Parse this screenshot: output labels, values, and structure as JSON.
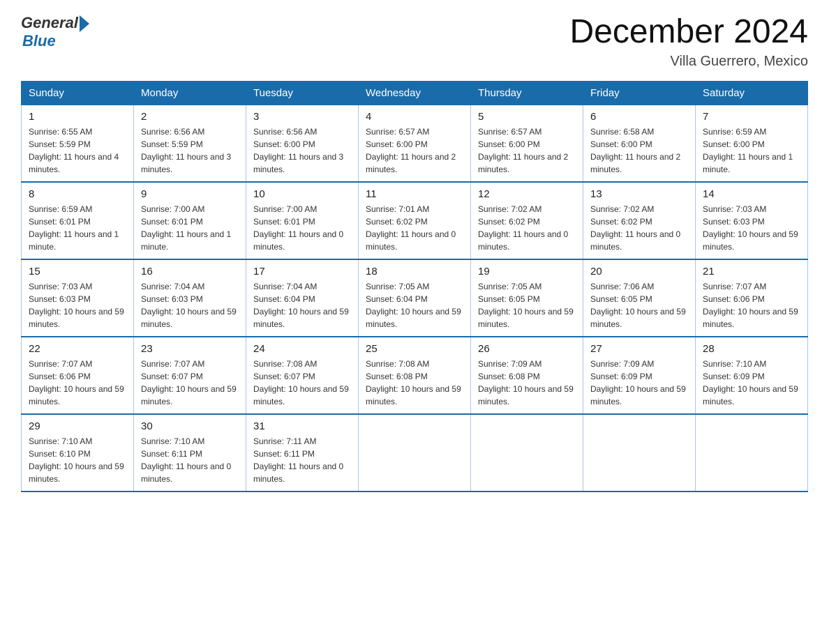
{
  "header": {
    "logo_general": "General",
    "logo_blue": "Blue",
    "month_title": "December 2024",
    "location": "Villa Guerrero, Mexico"
  },
  "weekdays": [
    "Sunday",
    "Monday",
    "Tuesday",
    "Wednesday",
    "Thursday",
    "Friday",
    "Saturday"
  ],
  "weeks": [
    [
      {
        "day": "1",
        "sunrise": "6:55 AM",
        "sunset": "5:59 PM",
        "daylight": "11 hours and 4 minutes."
      },
      {
        "day": "2",
        "sunrise": "6:56 AM",
        "sunset": "5:59 PM",
        "daylight": "11 hours and 3 minutes."
      },
      {
        "day": "3",
        "sunrise": "6:56 AM",
        "sunset": "6:00 PM",
        "daylight": "11 hours and 3 minutes."
      },
      {
        "day": "4",
        "sunrise": "6:57 AM",
        "sunset": "6:00 PM",
        "daylight": "11 hours and 2 minutes."
      },
      {
        "day": "5",
        "sunrise": "6:57 AM",
        "sunset": "6:00 PM",
        "daylight": "11 hours and 2 minutes."
      },
      {
        "day": "6",
        "sunrise": "6:58 AM",
        "sunset": "6:00 PM",
        "daylight": "11 hours and 2 minutes."
      },
      {
        "day": "7",
        "sunrise": "6:59 AM",
        "sunset": "6:00 PM",
        "daylight": "11 hours and 1 minute."
      }
    ],
    [
      {
        "day": "8",
        "sunrise": "6:59 AM",
        "sunset": "6:01 PM",
        "daylight": "11 hours and 1 minute."
      },
      {
        "day": "9",
        "sunrise": "7:00 AM",
        "sunset": "6:01 PM",
        "daylight": "11 hours and 1 minute."
      },
      {
        "day": "10",
        "sunrise": "7:00 AM",
        "sunset": "6:01 PM",
        "daylight": "11 hours and 0 minutes."
      },
      {
        "day": "11",
        "sunrise": "7:01 AM",
        "sunset": "6:02 PM",
        "daylight": "11 hours and 0 minutes."
      },
      {
        "day": "12",
        "sunrise": "7:02 AM",
        "sunset": "6:02 PM",
        "daylight": "11 hours and 0 minutes."
      },
      {
        "day": "13",
        "sunrise": "7:02 AM",
        "sunset": "6:02 PM",
        "daylight": "11 hours and 0 minutes."
      },
      {
        "day": "14",
        "sunrise": "7:03 AM",
        "sunset": "6:03 PM",
        "daylight": "10 hours and 59 minutes."
      }
    ],
    [
      {
        "day": "15",
        "sunrise": "7:03 AM",
        "sunset": "6:03 PM",
        "daylight": "10 hours and 59 minutes."
      },
      {
        "day": "16",
        "sunrise": "7:04 AM",
        "sunset": "6:03 PM",
        "daylight": "10 hours and 59 minutes."
      },
      {
        "day": "17",
        "sunrise": "7:04 AM",
        "sunset": "6:04 PM",
        "daylight": "10 hours and 59 minutes."
      },
      {
        "day": "18",
        "sunrise": "7:05 AM",
        "sunset": "6:04 PM",
        "daylight": "10 hours and 59 minutes."
      },
      {
        "day": "19",
        "sunrise": "7:05 AM",
        "sunset": "6:05 PM",
        "daylight": "10 hours and 59 minutes."
      },
      {
        "day": "20",
        "sunrise": "7:06 AM",
        "sunset": "6:05 PM",
        "daylight": "10 hours and 59 minutes."
      },
      {
        "day": "21",
        "sunrise": "7:07 AM",
        "sunset": "6:06 PM",
        "daylight": "10 hours and 59 minutes."
      }
    ],
    [
      {
        "day": "22",
        "sunrise": "7:07 AM",
        "sunset": "6:06 PM",
        "daylight": "10 hours and 59 minutes."
      },
      {
        "day": "23",
        "sunrise": "7:07 AM",
        "sunset": "6:07 PM",
        "daylight": "10 hours and 59 minutes."
      },
      {
        "day": "24",
        "sunrise": "7:08 AM",
        "sunset": "6:07 PM",
        "daylight": "10 hours and 59 minutes."
      },
      {
        "day": "25",
        "sunrise": "7:08 AM",
        "sunset": "6:08 PM",
        "daylight": "10 hours and 59 minutes."
      },
      {
        "day": "26",
        "sunrise": "7:09 AM",
        "sunset": "6:08 PM",
        "daylight": "10 hours and 59 minutes."
      },
      {
        "day": "27",
        "sunrise": "7:09 AM",
        "sunset": "6:09 PM",
        "daylight": "10 hours and 59 minutes."
      },
      {
        "day": "28",
        "sunrise": "7:10 AM",
        "sunset": "6:09 PM",
        "daylight": "10 hours and 59 minutes."
      }
    ],
    [
      {
        "day": "29",
        "sunrise": "7:10 AM",
        "sunset": "6:10 PM",
        "daylight": "10 hours and 59 minutes."
      },
      {
        "day": "30",
        "sunrise": "7:10 AM",
        "sunset": "6:11 PM",
        "daylight": "11 hours and 0 minutes."
      },
      {
        "day": "31",
        "sunrise": "7:11 AM",
        "sunset": "6:11 PM",
        "daylight": "11 hours and 0 minutes."
      },
      null,
      null,
      null,
      null
    ]
  ]
}
